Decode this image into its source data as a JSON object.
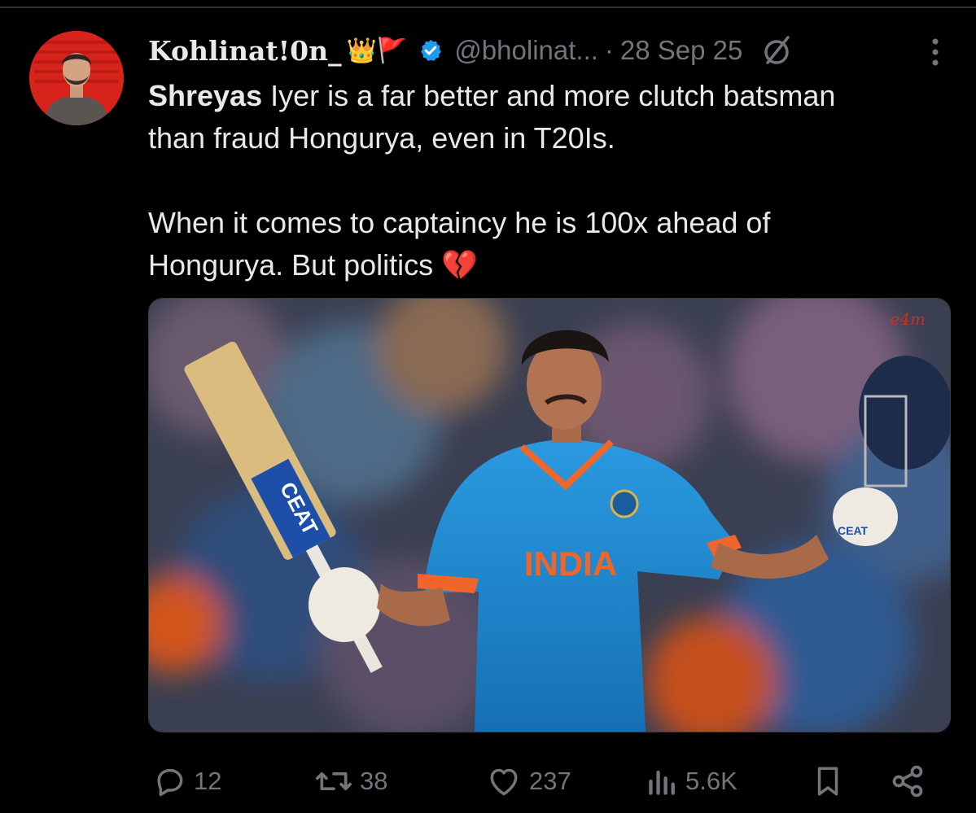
{
  "post": {
    "display_name": "Kohlinat!0n_",
    "name_emojis": "👑🚩",
    "handle": "@bholinat...",
    "separator": "·",
    "date": "28 Sep 25",
    "text": {
      "line1_bold": "Shreyas",
      "line1_rest": " Iyer is a far better and more clutch batsman",
      "line2": "than fraud Hongurya, even in T20Is.",
      "line3": "When it comes to captaincy he is 100x ahead of",
      "line4": "Hongurya. But politics",
      "line4_emoji": "💔"
    }
  },
  "media": {
    "watermark": "e4m",
    "jersey_text": "INDIA",
    "bat_brand": "CEAT",
    "glove_brand": "CEAT"
  },
  "actions": {
    "replies": "12",
    "reposts": "38",
    "likes": "237",
    "views": "5.6K"
  },
  "icons": {
    "verified": "verified-badge-icon",
    "grok": "grok-icon",
    "more": "more-dots-icon",
    "reply": "reply-icon",
    "repost": "repost-icon",
    "like": "heart-icon",
    "views": "views-icon",
    "bookmark": "bookmark-icon",
    "share": "share-icon"
  },
  "colors": {
    "background": "#000000",
    "text": "#e7e9ea",
    "muted": "#71767b",
    "verified": "#1d9bf0",
    "avatar_bg": "#d8231c",
    "jersey": "#1e8ad2"
  }
}
